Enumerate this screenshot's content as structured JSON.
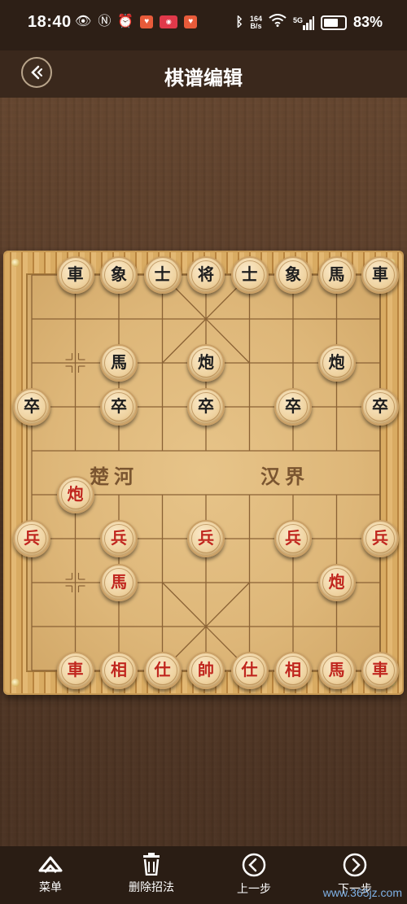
{
  "status_bar": {
    "time": "18:40",
    "speed_top": "164",
    "speed_bottom": "B/s",
    "network": "5G",
    "battery": "83%",
    "battery_level": 0.83
  },
  "header": {
    "title": "棋谱编辑"
  },
  "board": {
    "river_left": "楚河",
    "river_right": "汉界",
    "pieces": [
      {
        "id": "b-che-l",
        "char": "車",
        "color": "black",
        "col": 1,
        "row": 0
      },
      {
        "id": "b-xiang-l",
        "char": "象",
        "color": "black",
        "col": 2,
        "row": 0
      },
      {
        "id": "b-shi-l",
        "char": "士",
        "color": "black",
        "col": 3,
        "row": 0
      },
      {
        "id": "b-jiang",
        "char": "将",
        "color": "black",
        "col": 4,
        "row": 0
      },
      {
        "id": "b-shi-r",
        "char": "士",
        "color": "black",
        "col": 5,
        "row": 0
      },
      {
        "id": "b-xiang-r",
        "char": "象",
        "color": "black",
        "col": 6,
        "row": 0
      },
      {
        "id": "b-ma-r",
        "char": "馬",
        "color": "black",
        "col": 7,
        "row": 0
      },
      {
        "id": "b-che-r",
        "char": "車",
        "color": "black",
        "col": 8,
        "row": 0
      },
      {
        "id": "b-ma-l",
        "char": "馬",
        "color": "black",
        "col": 2,
        "row": 2
      },
      {
        "id": "b-pao-l",
        "char": "炮",
        "color": "black",
        "col": 4,
        "row": 2
      },
      {
        "id": "b-pao-r",
        "char": "炮",
        "color": "black",
        "col": 7,
        "row": 2
      },
      {
        "id": "b-zu-1",
        "char": "卒",
        "color": "black",
        "col": 0,
        "row": 3
      },
      {
        "id": "b-zu-2",
        "char": "卒",
        "color": "black",
        "col": 2,
        "row": 3
      },
      {
        "id": "b-zu-3",
        "char": "卒",
        "color": "black",
        "col": 4,
        "row": 3
      },
      {
        "id": "b-zu-4",
        "char": "卒",
        "color": "black",
        "col": 6,
        "row": 3
      },
      {
        "id": "b-zu-5",
        "char": "卒",
        "color": "black",
        "col": 8,
        "row": 3
      },
      {
        "id": "r-pao-l",
        "char": "炮",
        "color": "red",
        "col": 1,
        "row": 5
      },
      {
        "id": "r-bing-1",
        "char": "兵",
        "color": "red",
        "col": 0,
        "row": 6
      },
      {
        "id": "r-bing-2",
        "char": "兵",
        "color": "red",
        "col": 2,
        "row": 6
      },
      {
        "id": "r-bing-3",
        "char": "兵",
        "color": "red",
        "col": 4,
        "row": 6
      },
      {
        "id": "r-bing-4",
        "char": "兵",
        "color": "red",
        "col": 6,
        "row": 6
      },
      {
        "id": "r-bing-5",
        "char": "兵",
        "color": "red",
        "col": 8,
        "row": 6
      },
      {
        "id": "r-ma-l",
        "char": "馬",
        "color": "red",
        "col": 2,
        "row": 7
      },
      {
        "id": "r-pao-r",
        "char": "炮",
        "color": "red",
        "col": 7,
        "row": 7
      },
      {
        "id": "r-che-l",
        "char": "車",
        "color": "red",
        "col": 1,
        "row": 9
      },
      {
        "id": "r-xiang-l",
        "char": "相",
        "color": "red",
        "col": 2,
        "row": 9
      },
      {
        "id": "r-shi-l",
        "char": "仕",
        "color": "red",
        "col": 3,
        "row": 9
      },
      {
        "id": "r-shuai",
        "char": "帥",
        "color": "red",
        "col": 4,
        "row": 9
      },
      {
        "id": "r-shi-r",
        "char": "仕",
        "color": "red",
        "col": 5,
        "row": 9
      },
      {
        "id": "r-xiang-r",
        "char": "相",
        "color": "red",
        "col": 6,
        "row": 9
      },
      {
        "id": "r-ma-r",
        "char": "馬",
        "color": "red",
        "col": 7,
        "row": 9
      },
      {
        "id": "r-che-r",
        "char": "車",
        "color": "red",
        "col": 8,
        "row": 9
      }
    ]
  },
  "toolbar": {
    "menu_label": "菜单",
    "delete_label": "删除招法",
    "prev_label": "上一步",
    "next_label": "下一步"
  },
  "watermark": "www.365jz.com",
  "colors": {
    "red_piece_text": "#c0261e",
    "black_piece_text": "#1e1e1e",
    "toolbar_bg": "#2a1d14"
  }
}
